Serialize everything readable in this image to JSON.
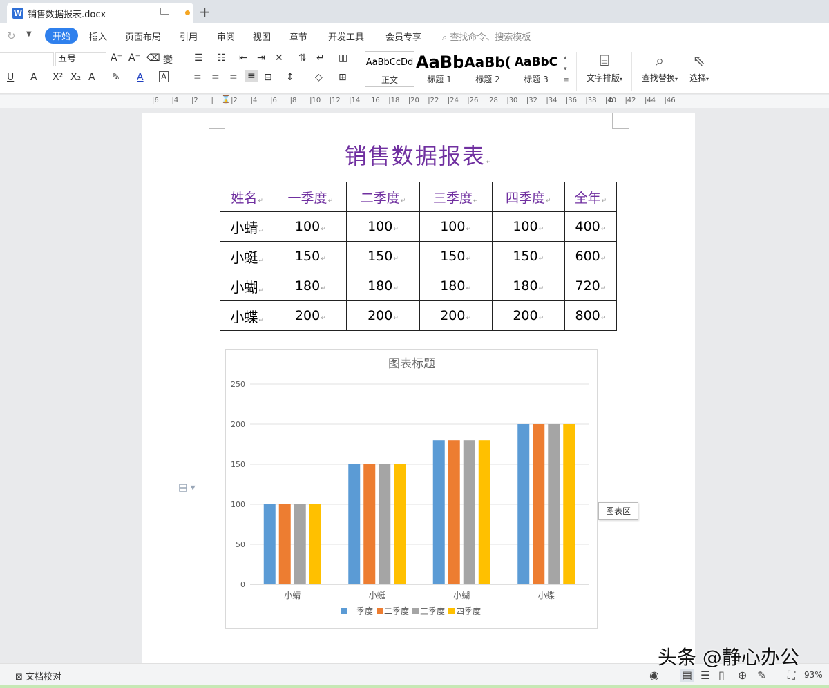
{
  "tab": {
    "title": "销售数据报表.docx",
    "app_icon": "W"
  },
  "menu": {
    "items": [
      "开始",
      "插入",
      "页面布局",
      "引用",
      "审阅",
      "视图",
      "章节",
      "开发工具",
      "会员专享"
    ],
    "search_placeholder": "查找命令、搜索模板"
  },
  "ribbon": {
    "font_size": "五号",
    "styles": [
      {
        "sample": "AaBbCcDd",
        "caption": "正文"
      },
      {
        "sample": "AaBb",
        "caption": "标题 1"
      },
      {
        "sample": "AaBb(",
        "caption": "标题 2"
      },
      {
        "sample": "AaBbC",
        "caption": "标题 3"
      }
    ],
    "text_layout_label": "文字排版",
    "find_replace_label": "查找替换",
    "select_label": "选择"
  },
  "ruler": {
    "ticks": [
      "6",
      "4",
      "2",
      "",
      "2",
      "4",
      "6",
      "8",
      "10",
      "12",
      "14",
      "16",
      "18",
      "20",
      "22",
      "24",
      "26",
      "28",
      "30",
      "32",
      "34",
      "36",
      "38",
      "40",
      "42",
      "44",
      "46"
    ]
  },
  "document": {
    "title": "销售数据报表",
    "table": {
      "headers": [
        "姓名",
        "一季度",
        "二季度",
        "三季度",
        "四季度",
        "全年"
      ],
      "rows": [
        [
          "小蜻",
          "100",
          "100",
          "100",
          "100",
          "400"
        ],
        [
          "小蜓",
          "150",
          "150",
          "150",
          "150",
          "600"
        ],
        [
          "小蝴",
          "180",
          "180",
          "180",
          "180",
          "720"
        ],
        [
          "小蝶",
          "200",
          "200",
          "200",
          "200",
          "800"
        ]
      ]
    }
  },
  "chart_data": {
    "type": "bar",
    "title": "图表标题",
    "categories": [
      "小蜻",
      "小蜓",
      "小蝴",
      "小蝶"
    ],
    "series": [
      {
        "name": "一季度",
        "values": [
          100,
          150,
          180,
          200
        ],
        "color": "#5b9bd5"
      },
      {
        "name": "二季度",
        "values": [
          100,
          150,
          180,
          200
        ],
        "color": "#ed7d31"
      },
      {
        "name": "三季度",
        "values": [
          100,
          150,
          180,
          200
        ],
        "color": "#a5a5a5"
      },
      {
        "name": "四季度",
        "values": [
          100,
          150,
          180,
          200
        ],
        "color": "#ffc000"
      }
    ],
    "ylim": [
      0,
      250
    ],
    "yticks": [
      0,
      50,
      100,
      150,
      200,
      250
    ],
    "grid": true,
    "legend": "bottom"
  },
  "chart_area_tooltip": "图表区",
  "status": {
    "proofread_label": "文档校对",
    "zoom": "93%"
  },
  "watermark": "头条 @静心办公",
  "colors": {
    "accent": "#2f80ed",
    "title_purple": "#7030a0"
  }
}
